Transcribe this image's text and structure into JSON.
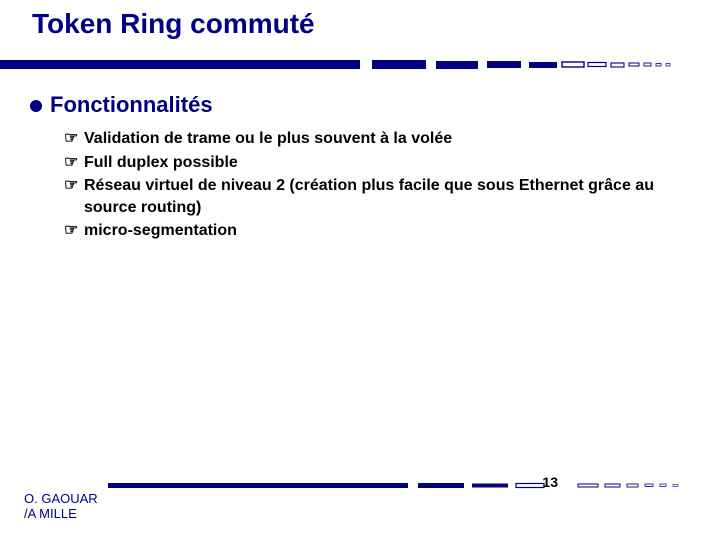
{
  "title": "Token Ring commuté",
  "section": {
    "header": "Fonctionnalités",
    "items": [
      "Validation de trame ou le plus souvent à la volée",
      "Full duplex possible",
      "Réseau virtuel de niveau 2 (création plus facile que sous Ethernet grâce au source routing)",
      "micro-segmentation"
    ]
  },
  "footer": {
    "author_line1": "O. GAOUAR",
    "author_line2": "/A MILLE",
    "page": "13"
  },
  "colors": {
    "accent": "#000080"
  }
}
